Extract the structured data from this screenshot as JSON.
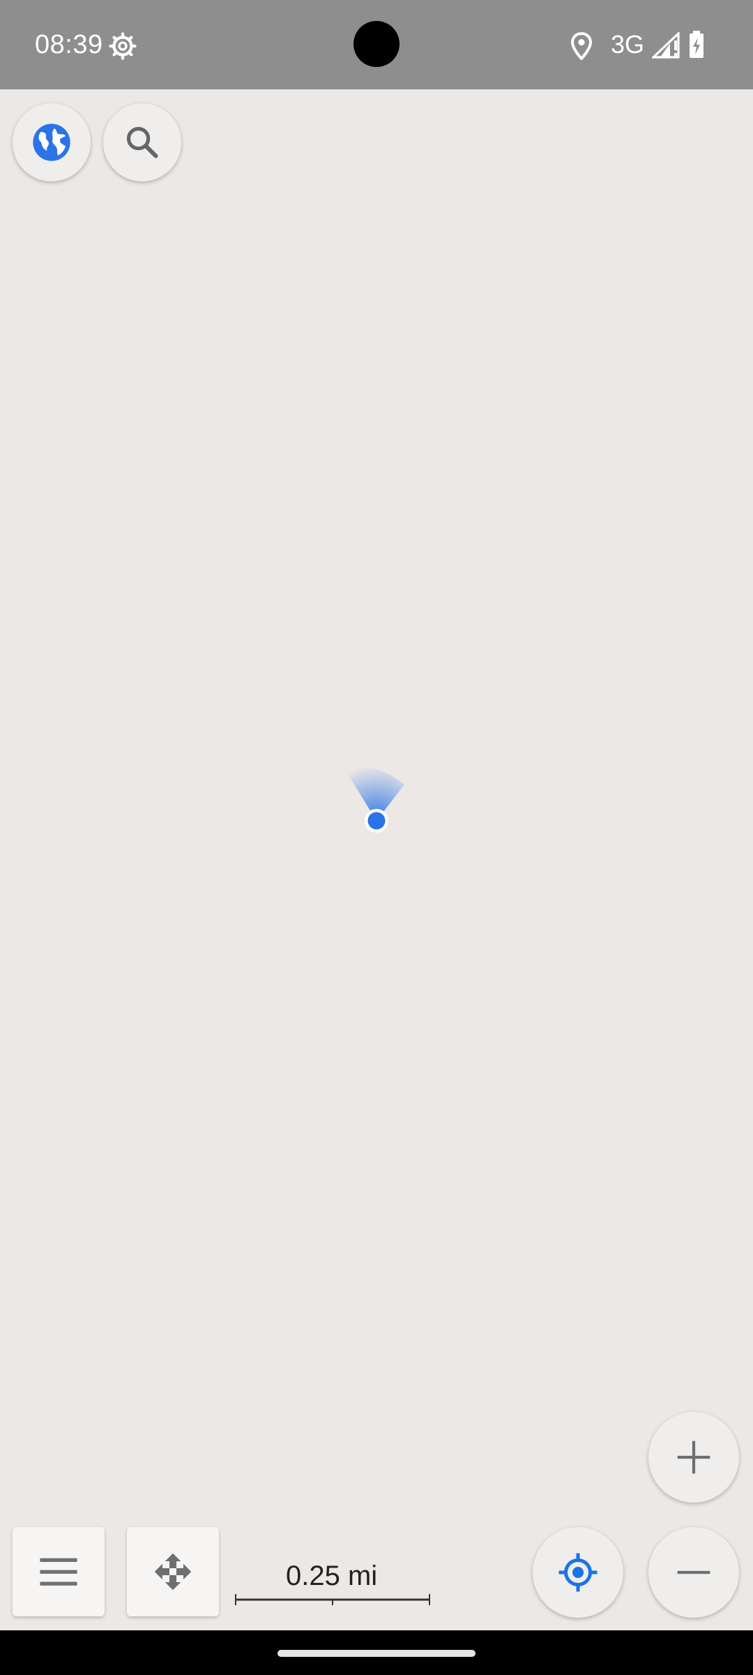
{
  "status_bar": {
    "time": "08:39",
    "network": "3G",
    "icons": [
      "settings-gear-icon",
      "location-pin-icon",
      "signal-icon",
      "battery-charging-icon"
    ]
  },
  "map": {
    "scale": "0.25 mi",
    "my_location_color": "#2a73e8",
    "controls": {
      "globe": "globe-icon",
      "search": "search-icon",
      "menu": "menu-icon",
      "route": "directions-icon",
      "locate": "my-location-icon",
      "zoom_in": "plus-icon",
      "zoom_out": "minus-icon"
    }
  },
  "colors": {
    "status_bar_bg": "#8e8e8e",
    "map_bg": "#ebe8e5",
    "accent": "#1a73e8"
  }
}
